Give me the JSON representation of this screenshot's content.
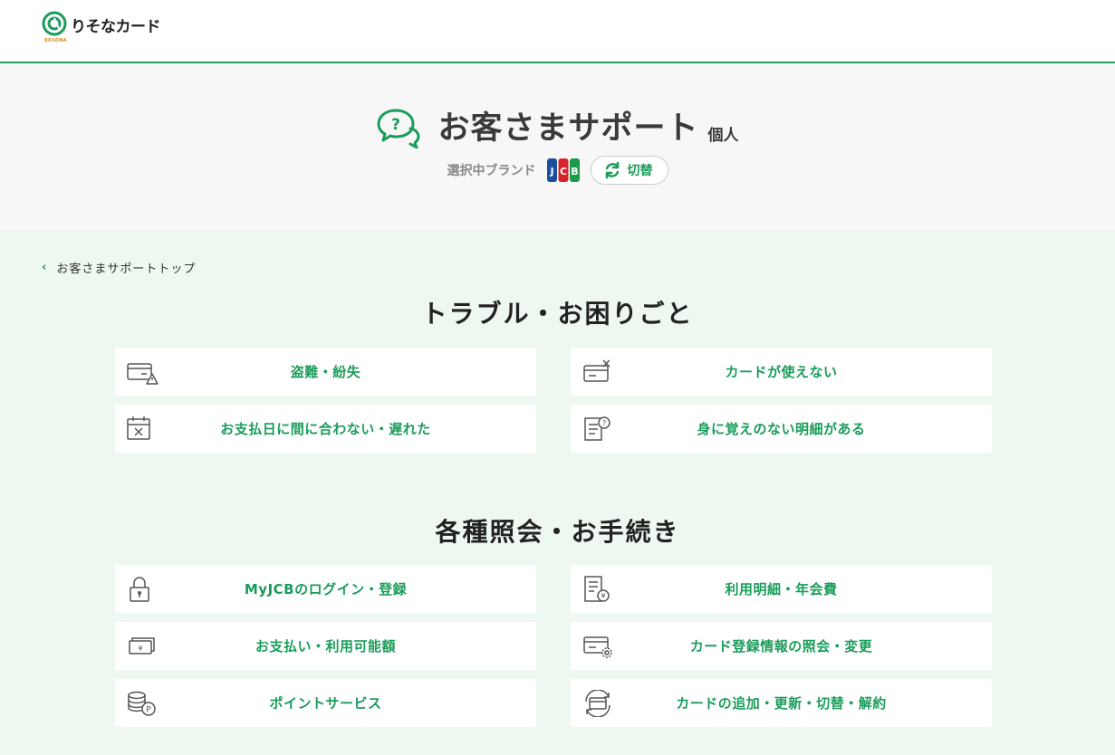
{
  "logo": {
    "text": "りそなカード",
    "sub": "RESONA"
  },
  "hero": {
    "title": "お客さまサポート",
    "subtitle": "個人",
    "brand_label": "選択中ブランド",
    "brand_name": "JCB",
    "switch_label": "切替"
  },
  "breadcrumb": {
    "back_label": "お客さまサポートトップ"
  },
  "sections": [
    {
      "title": "トラブル・お困りごと",
      "items": [
        {
          "label": "盗難・紛失",
          "icon": "card-warning-icon"
        },
        {
          "label": "カードが使えない",
          "icon": "card-x-icon"
        },
        {
          "label": "お支払日に間に合わない・遅れた",
          "icon": "calendar-x-icon"
        },
        {
          "label": "身に覚えのない明細がある",
          "icon": "statement-question-icon"
        }
      ]
    },
    {
      "title": "各種照会・お手続き",
      "items": [
        {
          "label": "MyJCBのログイン・登録",
          "icon": "lock-icon"
        },
        {
          "label": "利用明細・年会費",
          "icon": "statement-yen-icon"
        },
        {
          "label": "お支払い・利用可能額",
          "icon": "yen-bill-icon"
        },
        {
          "label": "カード登録情報の照会・変更",
          "icon": "card-gear-icon"
        },
        {
          "label": "ポイントサービス",
          "icon": "coins-point-icon"
        },
        {
          "label": "カードの追加・更新・切替・解約",
          "icon": "card-cycle-icon"
        }
      ]
    }
  ],
  "colors": {
    "accent": "#1a9c5a",
    "background": "#eef7f0",
    "hero_bg": "#f7f7f7"
  }
}
